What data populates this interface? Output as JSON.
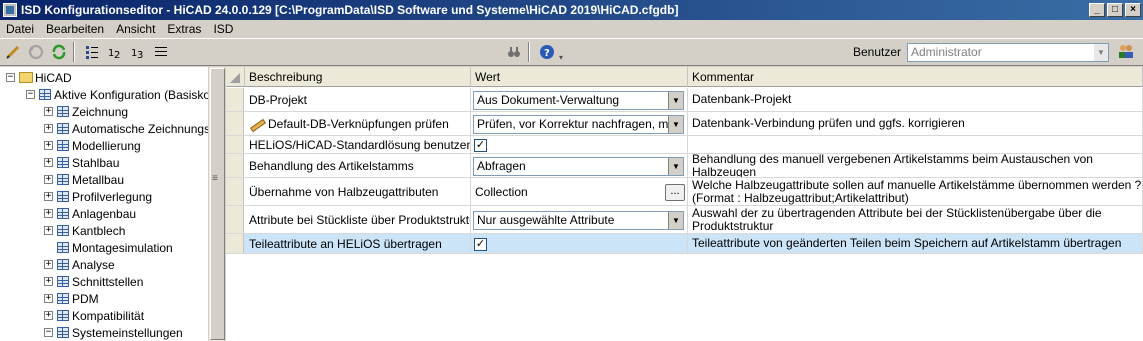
{
  "window": {
    "title": "ISD Konfigurationseditor  - HiCAD 24.0.0.129 [C:\\ProgramData\\ISD Software und Systeme\\HiCAD 2019\\HiCAD.cfgdb]",
    "minimize": "_",
    "maximize": "□",
    "close": "×"
  },
  "menu": [
    "Datei",
    "Bearbeiten",
    "Ansicht",
    "Extras",
    "ISD"
  ],
  "toolbar": {
    "user_label": "Benutzer",
    "user_value": "Administrator",
    "grip_glyph": "▾",
    "combo_arrow": "▼"
  },
  "tree": {
    "items": [
      {
        "label": "HiCAD",
        "expander": "−",
        "level": 0,
        "icon": "folder-icon"
      },
      {
        "label": "Aktive Konfiguration (Basiskonf",
        "expander": "−",
        "level": 1,
        "icon": "grid-icon"
      },
      {
        "label": "Zeichnung",
        "expander": "+",
        "level": 2,
        "icon": "grid-icon"
      },
      {
        "label": "Automatische Zeichnungsal",
        "expander": "+",
        "level": 2,
        "icon": "grid-icon"
      },
      {
        "label": "Modellierung",
        "expander": "+",
        "level": 2,
        "icon": "grid-icon"
      },
      {
        "label": "Stahlbau",
        "expander": "+",
        "level": 2,
        "icon": "grid-icon"
      },
      {
        "label": "Metallbau",
        "expander": "+",
        "level": 2,
        "icon": "grid-icon"
      },
      {
        "label": "Profilverlegung",
        "expander": "+",
        "level": 2,
        "icon": "grid-icon"
      },
      {
        "label": "Anlagenbau",
        "expander": "+",
        "level": 2,
        "icon": "grid-icon"
      },
      {
        "label": "Kantblech",
        "expander": "+",
        "level": 2,
        "icon": "grid-icon"
      },
      {
        "label": "Montagesimulation",
        "expander": "",
        "level": 2,
        "icon": "grid-icon"
      },
      {
        "label": "Analyse",
        "expander": "+",
        "level": 2,
        "icon": "grid-icon"
      },
      {
        "label": "Schnittstellen",
        "expander": "+",
        "level": 2,
        "icon": "grid-icon"
      },
      {
        "label": "PDM",
        "expander": "+",
        "level": 2,
        "icon": "grid-icon"
      },
      {
        "label": "Kompatibilität",
        "expander": "+",
        "level": 2,
        "icon": "grid-icon"
      },
      {
        "label": "Systemeinstellungen",
        "expander": "−",
        "level": 2,
        "icon": "grid-icon"
      }
    ]
  },
  "grid": {
    "columns": [
      "Beschreibung",
      "Wert",
      "Kommentar"
    ],
    "rows": [
      {
        "desc": "DB-Projekt",
        "type": "combo",
        "value": "Aus Dokument-Verwaltung",
        "comment": "Datenbank-Projekt"
      },
      {
        "desc": "Default-DB-Verknüpfungen prüfen",
        "type": "combo",
        "value": "Prüfen, vor Korrektur nachfragen, mit l",
        "comment": "Datenbank-Verbindung prüfen und ggfs. korrigieren",
        "icon": "pencil-icon"
      },
      {
        "desc": "HELiOS/HiCAD-Standardlösung benutzen",
        "type": "check",
        "value": "✓",
        "comment": ""
      },
      {
        "desc": "Behandlung des Artikelstamms",
        "type": "combo",
        "value": "Abfragen",
        "comment": "Behandlung des manuell vergebenen Artikelstamms beim Austauschen von Halbzeugen"
      },
      {
        "desc": "Übernahme von Halbzeugattributen",
        "type": "collection",
        "value": "Collection",
        "button": "...",
        "comment": "Welche Halbzeugattribute sollen auf manuelle Artikelstämme übernommen werden ? (Format : Halbzeugattribut;Artikelattribut)"
      },
      {
        "desc": "Attribute bei Stückliste über Produktstruktur",
        "type": "combo",
        "value": "Nur ausgewählte Attribute",
        "comment": "Auswahl der zu übertragenden Attribute bei der Stücklistenübergabe über die Produktstruktur"
      },
      {
        "desc": "Teileattribute an HELiOS übertragen",
        "type": "check",
        "value": "✓",
        "comment": "Teileattribute von geänderten Teilen beim Speichern auf Artikelstamm übertragen",
        "selected": true
      }
    ]
  }
}
